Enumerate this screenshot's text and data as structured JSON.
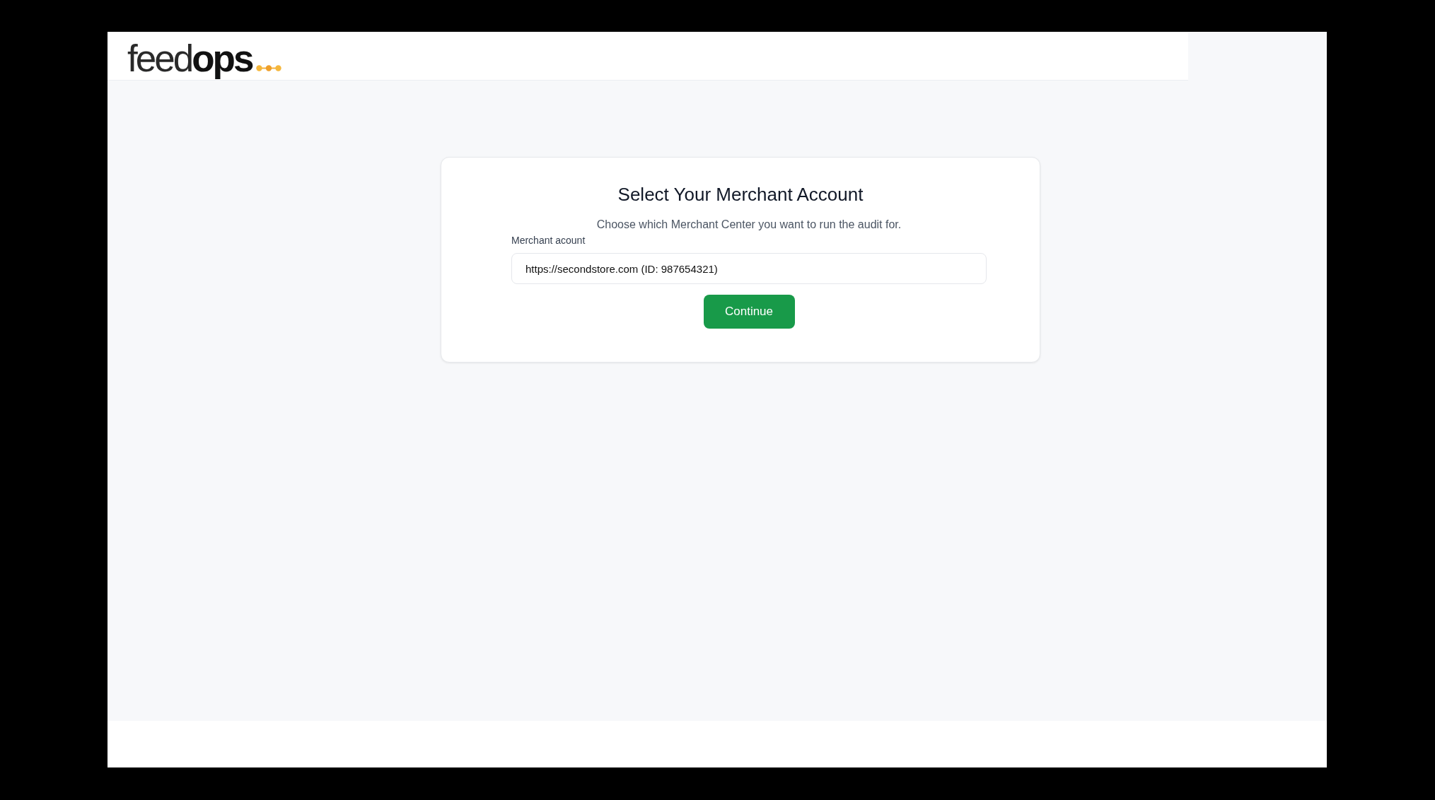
{
  "header": {
    "logo": "feed**ops**"
  },
  "card": {
    "title": "Select Your Merchant Account",
    "subtitle": "Choose which Merchant Center you want to run the audit for.",
    "merchant_field": {
      "label": "Merchant acount",
      "value": "https://secondstore.com (ID: 987654321)"
    },
    "button": "Continue"
  }
}
